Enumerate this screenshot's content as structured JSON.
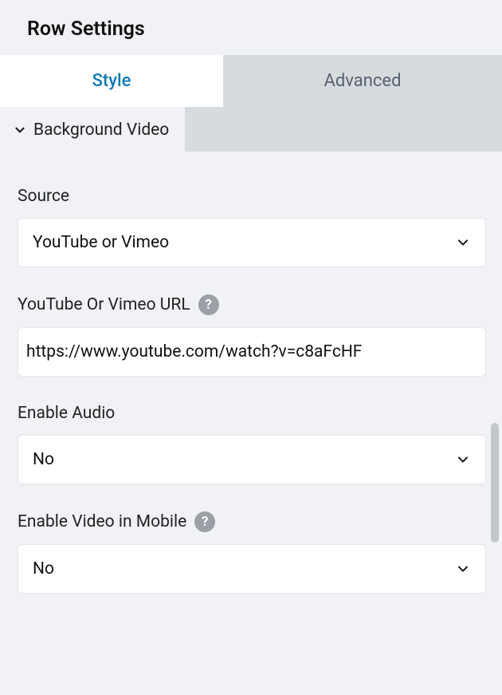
{
  "header": {
    "title": "Row Settings"
  },
  "tabs": {
    "style": "Style",
    "advanced": "Advanced",
    "active": "style"
  },
  "section": {
    "background_video_label": "Background Video"
  },
  "fields": {
    "source": {
      "label": "Source",
      "value": "YouTube or Vimeo"
    },
    "url": {
      "label": "YouTube Or Vimeo URL",
      "value": "https://www.youtube.com/watch?v=c8aFcHF"
    },
    "enable_audio": {
      "label": "Enable Audio",
      "value": "No"
    },
    "enable_video_mobile": {
      "label": "Enable Video in Mobile",
      "value": "No"
    }
  }
}
